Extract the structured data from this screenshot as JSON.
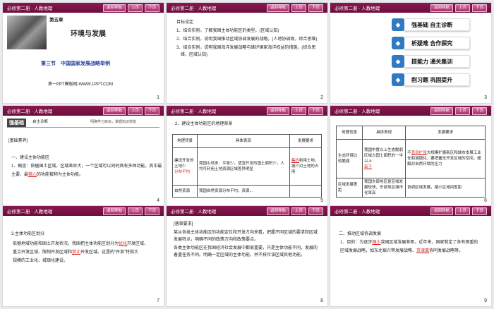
{
  "header": {
    "title": "必修第二册 · 人教地理",
    "nav": "返回导航",
    "prev": "上页",
    "next": "下页"
  },
  "slides": [
    {
      "num": "1",
      "chapter": "第五章",
      "title": "环境与发展",
      "section": "第三节　中国国家发展战略举例",
      "credit": "第一PPT模板网-WWW.1PPT.COM"
    },
    {
      "num": "2",
      "heading": "目标设定",
      "lines": [
        "1．结合实例，了解我国主体功能区的类型。(区域认知)",
        "2．结合实例，说明我国推动区域协调发展的战略。(人地协调观，综合思维)",
        "3．结合实例，说明我国海洋发展战略与维护国家海洋权益的措施。(综合思",
        "维，区域认知)"
      ]
    },
    {
      "num": "3",
      "menu": [
        "强基础 自主诊断",
        "析疑难 合作探究",
        "提能力 通关集训",
        "削习题 巩固提升"
      ]
    },
    {
      "num": "4",
      "badge": "强基础",
      "badge_sub": "自主诊断",
      "badge_note": "明确学习目标，掌握知识技能",
      "tag": "[基础素养]",
      "h1": "一、建设主体功能区",
      "p1": "1．概念：依据国土区域，区域差异大，一个区域可以同时具有多种功能，其中最",
      "p2a": "主要、最",
      "p2fill": "核心",
      "p2b": "的功能被称为主体功能。"
    },
    {
      "num": "5",
      "h": "2．建设主体功能区的地理背景",
      "cols": [
        "地理背景",
        "具体表现",
        "发展要求"
      ],
      "r1c1": "建设开发的土地少",
      "r1c1fill": "分布不均",
      "r1c2": "我国山地多、平原少，适宜开发的国土面积少，人均可利用土地资源区域差异明显",
      "r1c3a": "集约",
      "r1c3b": "利用土地，减少对土地的占用",
      "r2c1": "自然资源",
      "r2c2": "我国自然资源分布不均，资源..."
    },
    {
      "num": "6",
      "cols": [
        "地理背景",
        "具体表现",
        "发展要求"
      ],
      "r1c1": "生态环境比较脆弱",
      "r1c2a": "我国中度以上生态脆弱区域占国土面积的一半以上",
      "r1fill": "高于",
      "r1c3a": "不",
      "r1c3fill": "盲目扩张",
      "r1c3b": "大规模扩展新区和城市发展工业化和城镇化，要把握无开发区域的空间，缓解对自然环境的压力",
      "r2c1": "区域发展差距",
      "r2c2": "我国东部地区是区域发展较快，东部地区城市化率高",
      "r2c3": "协调区域发展，缩小区域间差距"
    },
    {
      "num": "7",
      "h": "3.主体功能区划分",
      "l1a": "依据地域功能和国土开发状况，我国把主体功能区划分为",
      "fill1": "优化",
      "l1b": "开发区域、",
      "l2a": "重点开发区域、限制开发区域和",
      "fill2": "禁止",
      "l2b": "开发区域。这里的“开发”特指大",
      "l3": "规模的工业化、城镇化建设。"
    },
    {
      "num": "8",
      "tag": "[落事要求]",
      "lines": [
        "某从各类主体功能区的功能定位和开发方向来看，把握不同区域的要求和区域",
        "发展特点，明确不同的政策方向和政策要点。",
        "各类主体功能区在我国经济社会发展中都很重要，只是主体功能不同。发展的",
        "着重任务不同。明确一定区域的主体功能，并不排斥该区域其他功能。"
      ]
    },
    {
      "num": "9",
      "h": "二、推动区域协调发展",
      "l1a": "1．目的：为逐步",
      "fill1": "缩小",
      "l1b": "我国区域发展差距，近年来，国家制定了各有侧重的",
      "l2a": "区域发展战略，如东北振兴等发展战略、",
      "fill2": "京津冀",
      "l2b": "协同发展战略等。"
    }
  ]
}
